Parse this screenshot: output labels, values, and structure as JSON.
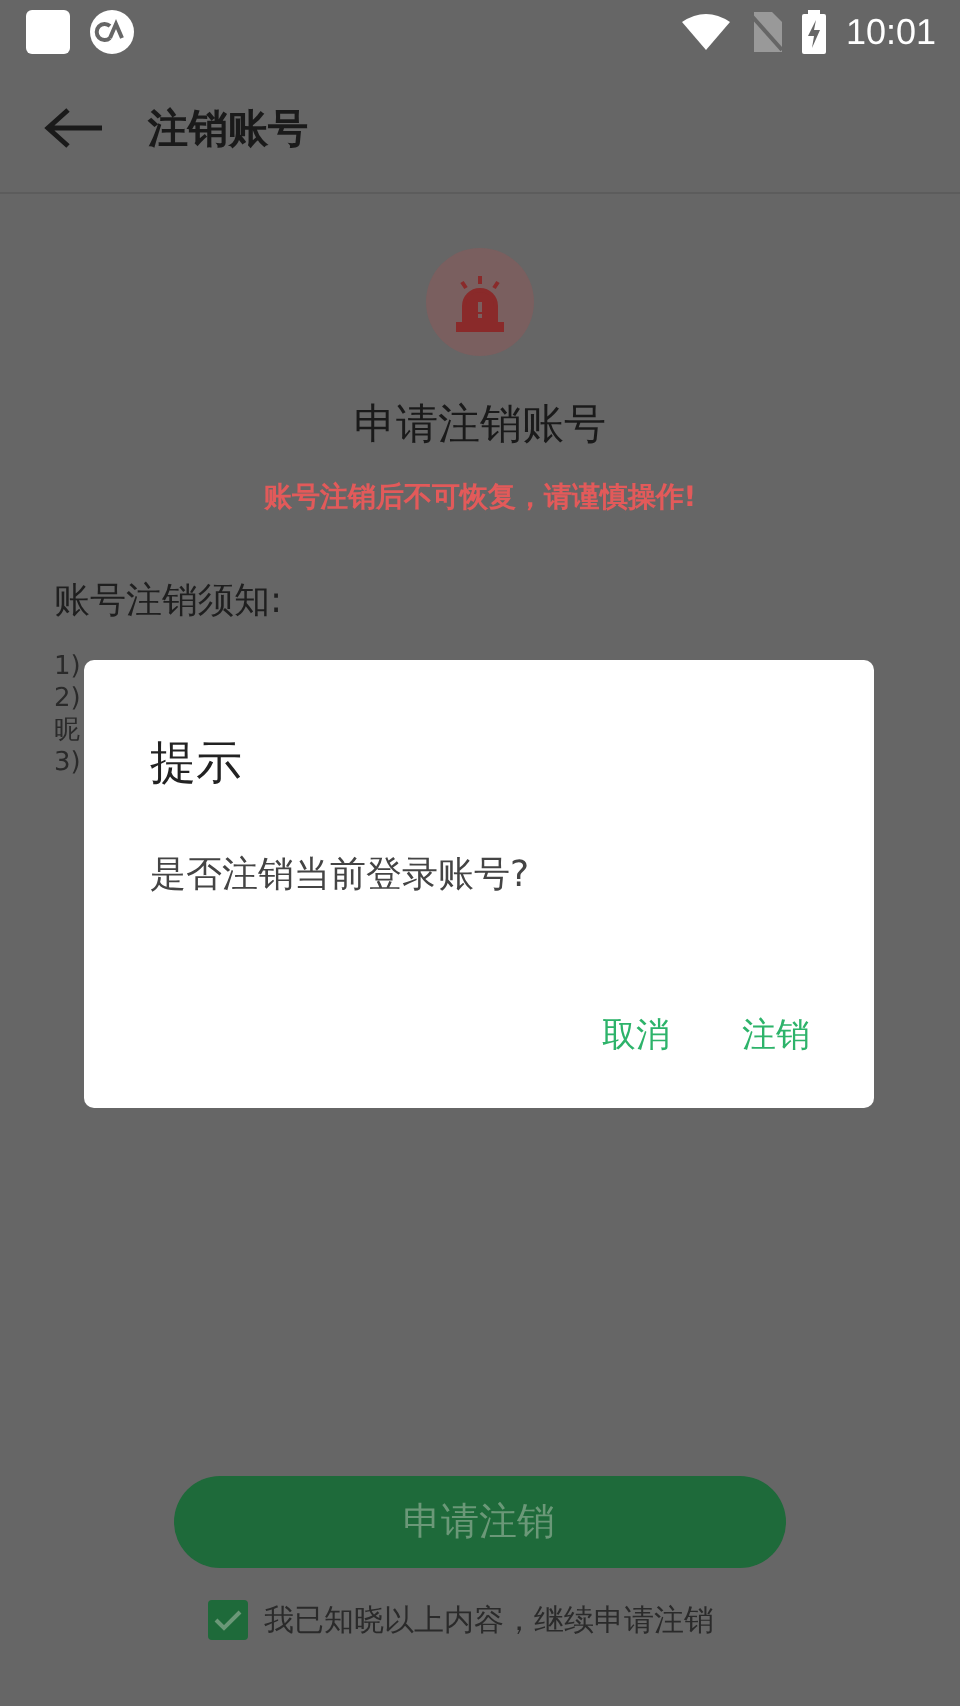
{
  "status_bar": {
    "time": "10:01"
  },
  "toolbar": {
    "title": "注销账号"
  },
  "header": {
    "title": "申请注销账号",
    "warning": "账号注销后不可恢复，请谨慎操作!"
  },
  "notice": {
    "heading": "账号注销须知:",
    "lines": [
      "1)",
      "2)",
      "昵",
      "3)"
    ]
  },
  "dialog": {
    "title": "提示",
    "message": "是否注销当前登录账号?",
    "buttons": [
      {
        "label": "取消"
      },
      {
        "label": "注销"
      }
    ]
  },
  "submit_button": {
    "label": "申请注销"
  },
  "agreement": {
    "label": "我已知晓以上内容，继续申请注销",
    "checked": true
  }
}
